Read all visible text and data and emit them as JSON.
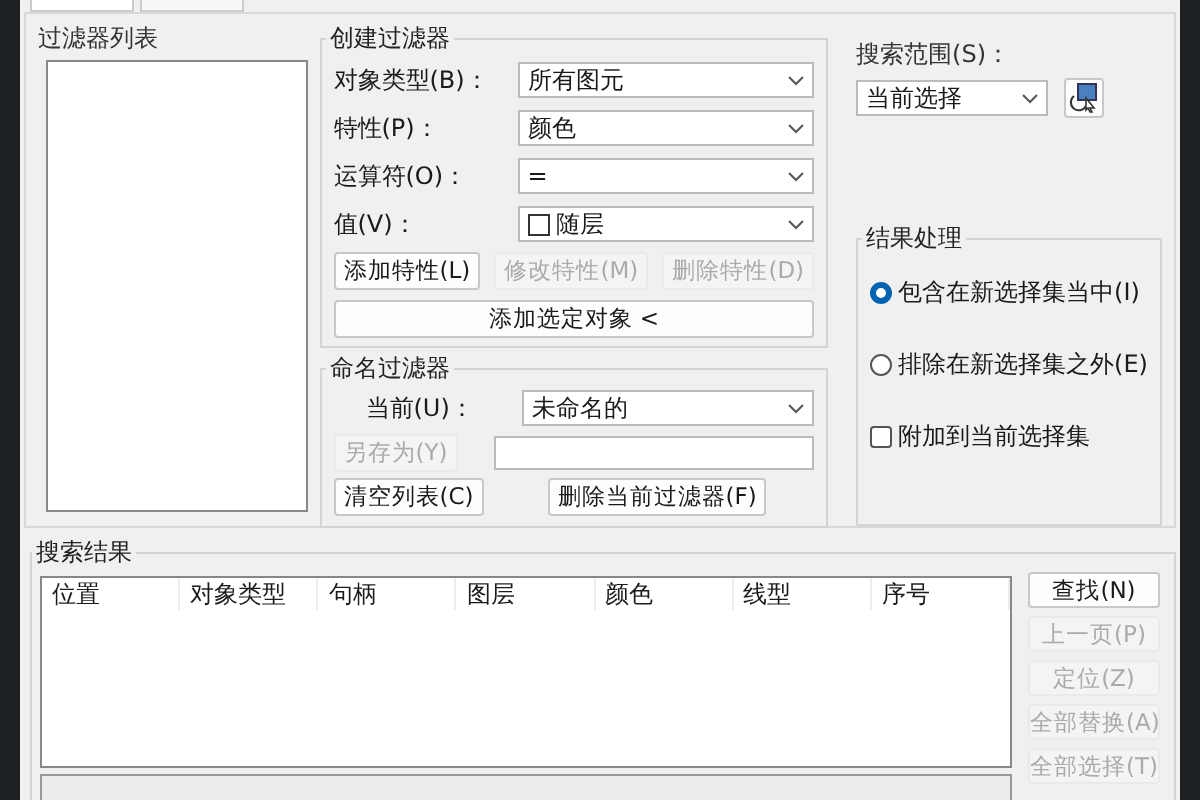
{
  "filter_list": {
    "title": "过滤器列表"
  },
  "create_filter": {
    "title": "创建过滤器",
    "fields": [
      {
        "label": "对象类型(B)：",
        "value": "所有图元",
        "swatch": false
      },
      {
        "label": "特性(P)：",
        "value": "颜色",
        "swatch": false
      },
      {
        "label": "运算符(O)：",
        "value": "=",
        "swatch": false
      },
      {
        "label": "值(V)：",
        "value": "随层",
        "swatch": true
      }
    ],
    "buttons": [
      {
        "label": "添加特性(L)",
        "disabled": false
      },
      {
        "label": "修改特性(M)",
        "disabled": true
      },
      {
        "label": "删除特性(D)",
        "disabled": true
      }
    ],
    "add_selected": {
      "label": "添加选定对象 <",
      "disabled": false
    }
  },
  "named_filter": {
    "title": "命名过滤器",
    "current_label": "当前(U)：",
    "current_value": "未命名的",
    "save_as": {
      "label": "另存为(Y)",
      "disabled": true
    },
    "clear": {
      "label": "清空列表(C)",
      "disabled": false
    },
    "delete": {
      "label": "删除当前过滤器(F)",
      "disabled": false
    }
  },
  "search_scope": {
    "label": "搜索范围(S)：",
    "value": "当前选择"
  },
  "result_handling": {
    "title": "结果处理",
    "options": [
      {
        "kind": "radio",
        "label": "包含在新选择集当中(I)",
        "selected": true
      },
      {
        "kind": "radio",
        "label": "排除在新选择集之外(E)",
        "selected": false
      },
      {
        "kind": "checkbox",
        "label": "附加到当前选择集",
        "checked": false
      }
    ]
  },
  "search_results": {
    "title": "搜索结果",
    "columns": [
      "位置",
      "对象类型",
      "句柄",
      "图层",
      "颜色",
      "线型",
      "序号"
    ],
    "actions": [
      {
        "label": "查找(N)",
        "disabled": false
      },
      {
        "label": "上一页(P)",
        "disabled": true
      },
      {
        "label": "定位(Z)",
        "disabled": true
      },
      {
        "label": "全部替换(A)",
        "disabled": true
      },
      {
        "label": "全部选择(T)",
        "disabled": true
      }
    ]
  }
}
